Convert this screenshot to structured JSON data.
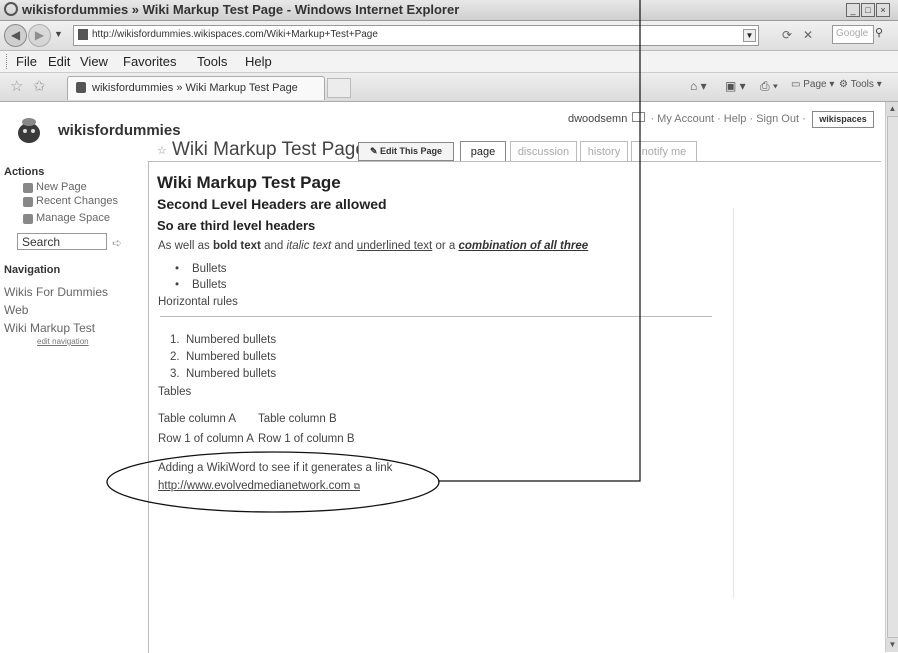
{
  "window": {
    "title": "wikisfordummies » Wiki Markup Test Page - Windows Internet Explorer",
    "address_url": "http://wikisfordummies.wikispaces.com/Wiki+Markup+Test+Page",
    "search_placeholder": "Google"
  },
  "menu": [
    "File",
    "Edit",
    "View",
    "Favorites",
    "Tools",
    "Help"
  ],
  "tab": {
    "label": "wikisfordummies » Wiki Markup Test Page"
  },
  "ie_tools": {
    "page": "Page",
    "tools": "Tools"
  },
  "header": {
    "site_name": "wikisfordummies",
    "username": "dwoodsemn",
    "account_links": "· My Account · Help · Sign Out ·",
    "wikispaces_logo": "wikispaces",
    "page_title": "Wiki Markup Test Page",
    "edit_button": "Edit This Page",
    "tabs": [
      "page",
      "discussion",
      "history",
      "notify me"
    ]
  },
  "sidebar": {
    "actions_heading": "Actions",
    "actions": [
      "New Page",
      "Recent Changes",
      "Manage Space"
    ],
    "search_value": "Search",
    "navigation_heading": "Navigation",
    "nav_items": [
      "Wikis For Dummies",
      "Web",
      "Wiki Markup Test"
    ],
    "edit_navigation": "edit navigation"
  },
  "content": {
    "h1": "Wiki Markup Test Page",
    "h2": "Second Level Headers are allowed",
    "h3": "So are third level headers",
    "formatting": {
      "prefix": "As well as ",
      "bold": "bold text",
      "and1": " and ",
      "italic": "italic text",
      "and2": " and ",
      "underline": "underlined text",
      "or": " or a ",
      "combo": "combination of all three"
    },
    "bullets": [
      "Bullets",
      "Bullets"
    ],
    "horizontal_rules": "Horizontal rules",
    "numbered": [
      "Numbered bullets",
      "Numbered bullets",
      "Numbered bullets"
    ],
    "tables_label": "Tables",
    "table": {
      "headers": [
        "Table column A",
        "Table column B"
      ],
      "rows": [
        [
          "Row 1 of column A",
          "Row 1 of column B"
        ]
      ]
    },
    "wikiword": "Adding a WikiWord to see if it generates a link",
    "link": "http://www.evolvedmedianetwork.com"
  }
}
